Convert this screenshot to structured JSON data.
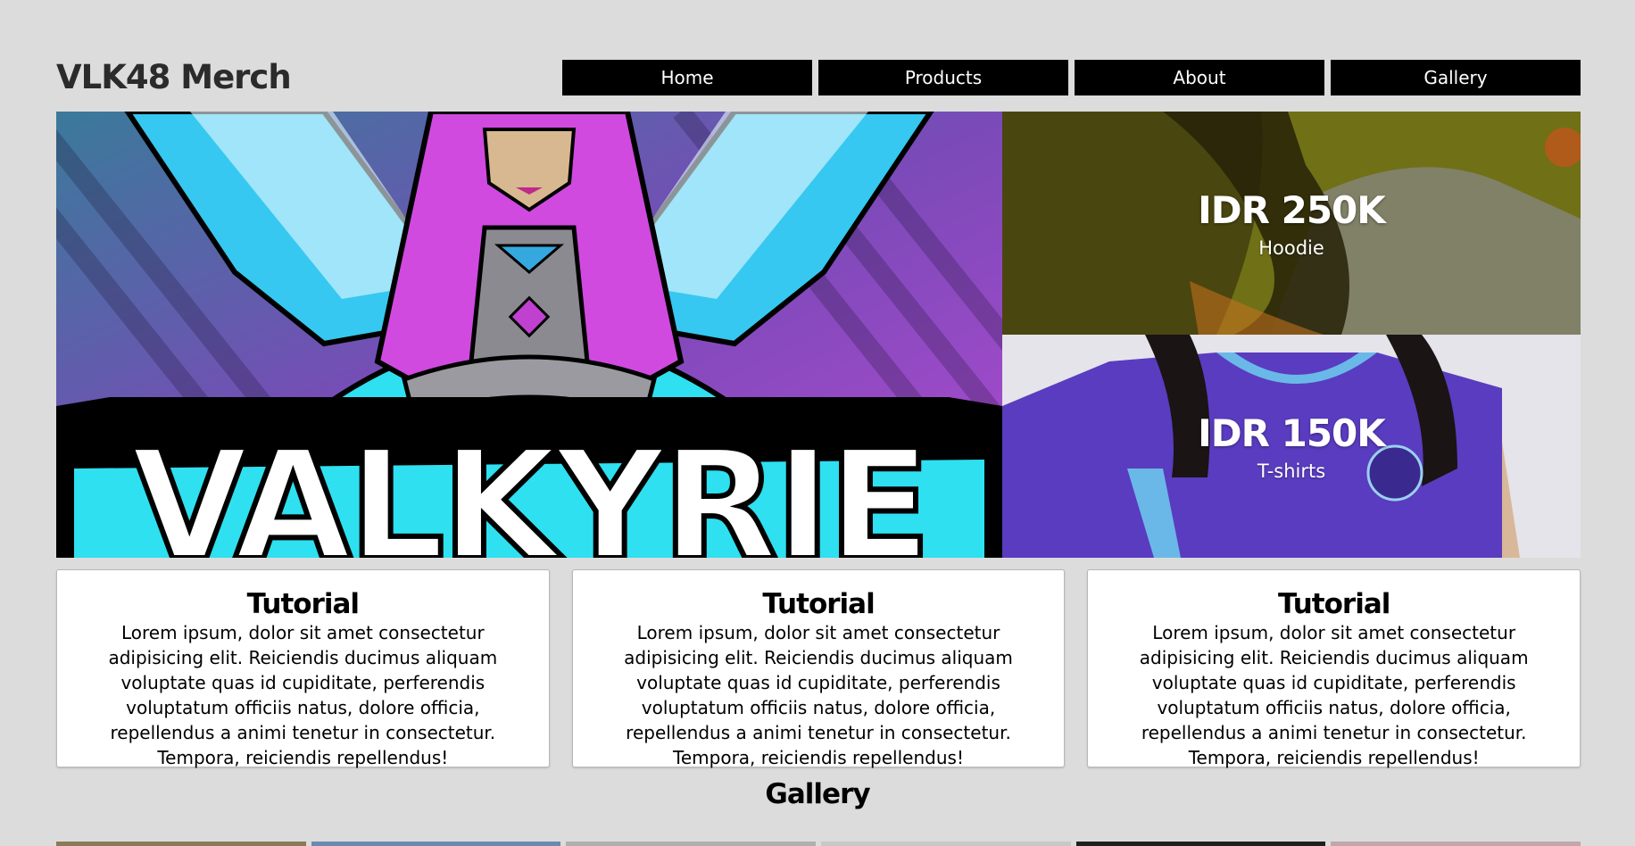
{
  "header": {
    "brand": "VLK48 Merch",
    "nav": [
      "Home",
      "Products",
      "About",
      "Gallery"
    ]
  },
  "hero": {
    "banner_text": "VALKYRIE",
    "promos": [
      {
        "price": "IDR 250K",
        "label": "Hoodie"
      },
      {
        "price": "IDR 150K",
        "label": "T-shirts"
      }
    ]
  },
  "cards": [
    {
      "title": "Tutorial",
      "body": "Lorem ipsum, dolor sit amet consectetur adipisicing elit. Reiciendis ducimus aliquam voluptate quas id cupiditate, perferendis voluptatum officiis natus, dolore officia, repellendus a animi tenetur in consectetur. Tempora, reiciendis repellendus!"
    },
    {
      "title": "Tutorial",
      "body": "Lorem ipsum, dolor sit amet consectetur adipisicing elit. Reiciendis ducimus aliquam voluptate quas id cupiditate, perferendis voluptatum officiis natus, dolore officia, repellendus a animi tenetur in consectetur. Tempora, reiciendis repellendus!"
    },
    {
      "title": "Tutorial",
      "body": "Lorem ipsum, dolor sit amet consectetur adipisicing elit. Reiciendis ducimus aliquam voluptate quas id cupiditate, perferendis voluptatum officiis natus, dolore officia, repellendus a animi tenetur in consectetur. Tempora, reiciendis repellendus!"
    }
  ],
  "gallery": {
    "title": "Gallery",
    "thumb_colors": [
      "#8a7a5a",
      "#6a8ab0",
      "#b0b0b0",
      "#c8c8c8",
      "#202020",
      "#c0a8a8"
    ]
  },
  "colors": {
    "page_bg": "#dcdcdc",
    "nav_bg": "#000000",
    "banner_purple": "#9b47c8",
    "banner_cyan": "#2ee0f0",
    "hoodie_tint": "#8a8a1a",
    "tshirt_purple": "#5a3cc0"
  }
}
